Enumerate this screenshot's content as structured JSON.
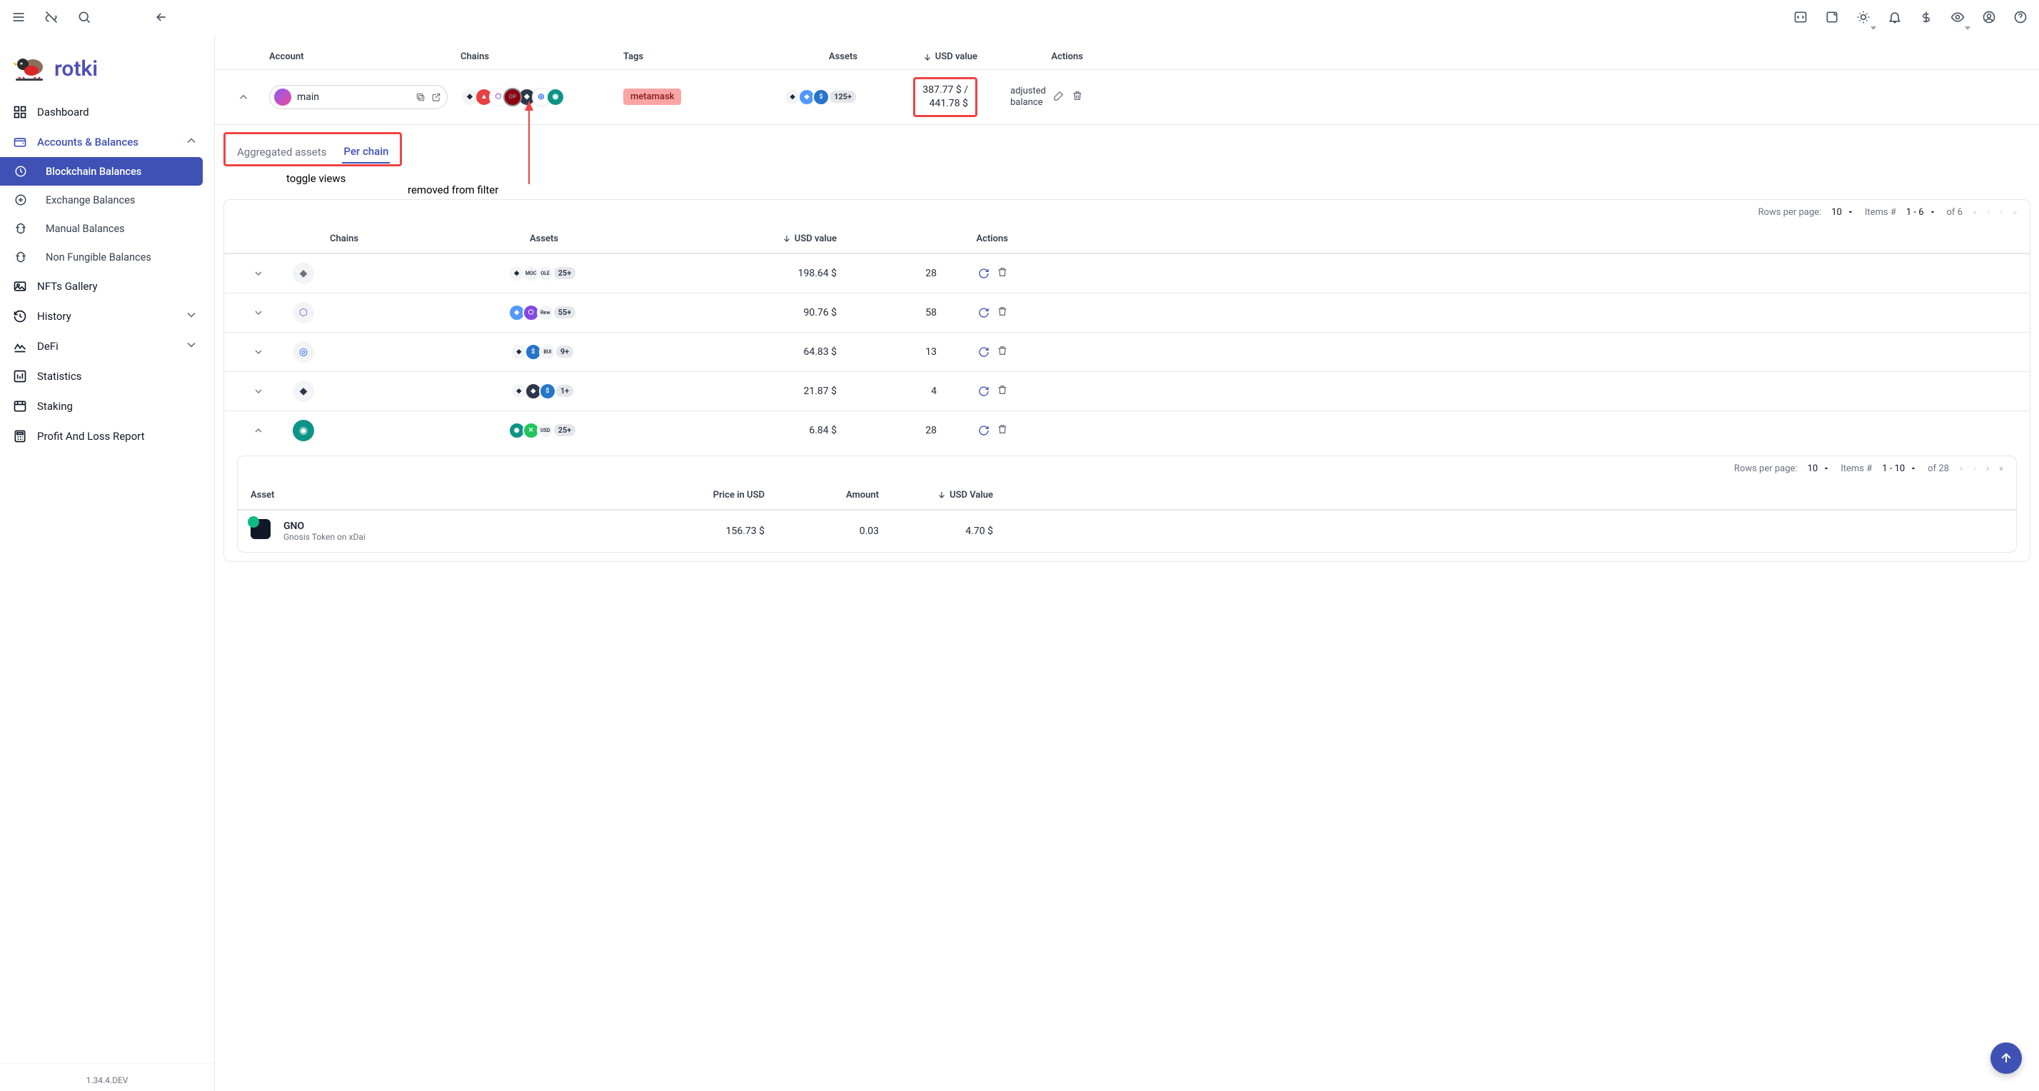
{
  "app": {
    "name": "rotki",
    "version": "1.34.4.DEV"
  },
  "sidebar": {
    "items": [
      {
        "label": "Dashboard"
      },
      {
        "label": "Accounts & Balances"
      },
      {
        "label": "NFTs Gallery"
      },
      {
        "label": "History"
      },
      {
        "label": "DeFi"
      },
      {
        "label": "Statistics"
      },
      {
        "label": "Staking"
      },
      {
        "label": "Profit And Loss Report"
      }
    ],
    "sub": [
      {
        "label": "Blockchain Balances"
      },
      {
        "label": "Exchange Balances"
      },
      {
        "label": "Manual Balances"
      },
      {
        "label": "Non Fungible Balances"
      }
    ]
  },
  "account_table": {
    "headers": {
      "account": "Account",
      "chains": "Chains",
      "tags": "Tags",
      "assets": "Assets",
      "usd": "USD value",
      "actions": "Actions"
    },
    "row": {
      "name": "main",
      "tag": "metamask",
      "assets_more": "125+",
      "usd_line1": "387.77 $ /",
      "usd_line2": "441.78 $",
      "adjusted_line1": "adjusted",
      "adjusted_line2": "balance"
    }
  },
  "tabs": {
    "agg": "Aggregated assets",
    "per": "Per chain"
  },
  "annotations": {
    "toggle": "toggle views",
    "removed": "removed from filter"
  },
  "pager1": {
    "rows_label": "Rows per page:",
    "rows_value": "10",
    "items_label": "Items #",
    "range": "1 - 6",
    "of": "of 6"
  },
  "chain_table": {
    "headers": {
      "chains": "Chains",
      "assets": "Assets",
      "usd": "USD value",
      "actions": "Actions"
    },
    "rows": [
      {
        "more": "25+",
        "a1": "MOC",
        "a2": "OLE",
        "usd": "198.64 $",
        "count": "28"
      },
      {
        "more": "55+",
        "a1": "",
        "a2": "Rew",
        "usd": "90.76 $",
        "count": "58"
      },
      {
        "more": "9+",
        "a1": "",
        "a2": "BUI",
        "usd": "64.83 $",
        "count": "13"
      },
      {
        "more": "1+",
        "a1": "",
        "a2": "",
        "usd": "21.87 $",
        "count": "4"
      },
      {
        "more": "25+",
        "a1": "",
        "a2": "USD",
        "usd": "6.84 $",
        "count": "28"
      }
    ]
  },
  "pager2": {
    "rows_label": "Rows per page:",
    "rows_value": "10",
    "items_label": "Items #",
    "range": "1 - 10",
    "of": "of 28"
  },
  "asset_table": {
    "headers": {
      "asset": "Asset",
      "price": "Price in USD",
      "amount": "Amount",
      "usd": "USD Value"
    },
    "row": {
      "symbol": "GNO",
      "desc": "Gnosis Token on xDai",
      "price": "156.73 $",
      "amount": "0.03",
      "usd": "4.70 $"
    }
  }
}
